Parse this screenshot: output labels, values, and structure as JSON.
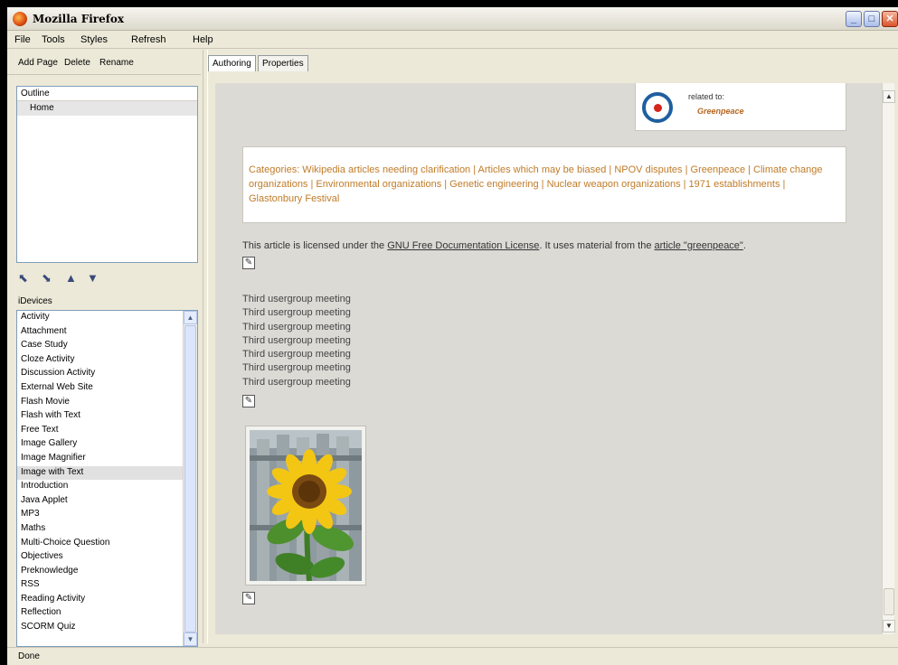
{
  "window": {
    "title": "Mozilla Firefox",
    "controls": [
      "_",
      "□",
      "✕"
    ]
  },
  "menu": [
    "File",
    "Tools",
    "Styles",
    "Refresh",
    "Help"
  ],
  "left_toolbar": [
    "Add Page",
    "Delete",
    "Rename"
  ],
  "outline": {
    "header": "Outline",
    "items": [
      "Home"
    ]
  },
  "devices": {
    "label": "iDevices",
    "items": [
      "Activity",
      "Attachment",
      "Case Study",
      "Cloze Activity",
      "Discussion Activity",
      "External Web Site",
      "Flash Movie",
      "Flash with Text",
      "Free Text",
      "Image Gallery",
      "Image Magnifier",
      "Image with Text",
      "Introduction",
      "Java Applet",
      "MP3",
      "Maths",
      "Multi-Choice Question",
      "Objectives",
      "Preknowledge",
      "RSS",
      "Reading Activity",
      "Reflection",
      "SCORM Quiz"
    ],
    "selected": "Image with Text"
  },
  "tabs": [
    "Authoring",
    "Properties"
  ],
  "content": {
    "related_label": "related to:",
    "related_link": "Greenpeace",
    "categories": "Categories: Wikipedia articles needing clarification | Articles which may be biased | NPOV disputes | Greenpeace | Climate change organizations | Environmental organizations | Genetic engineering | Nuclear weapon organizations | 1971 establishments | Glastonbury Festival",
    "license_prefix": "This article is licensed under the",
    "license_link": "GNU Free Documentation License",
    "license_mid": ". It uses material from the",
    "article_link": "article \"greenpeace\"",
    "license_suffix": ".",
    "meetings": [
      "Third usergroup meeting",
      "Third usergroup meeting",
      "Third usergroup meeting",
      "Third usergroup meeting",
      "Third usergroup meeting",
      "Third usergroup meeting",
      "Third usergroup meeting"
    ]
  },
  "status": "Done"
}
